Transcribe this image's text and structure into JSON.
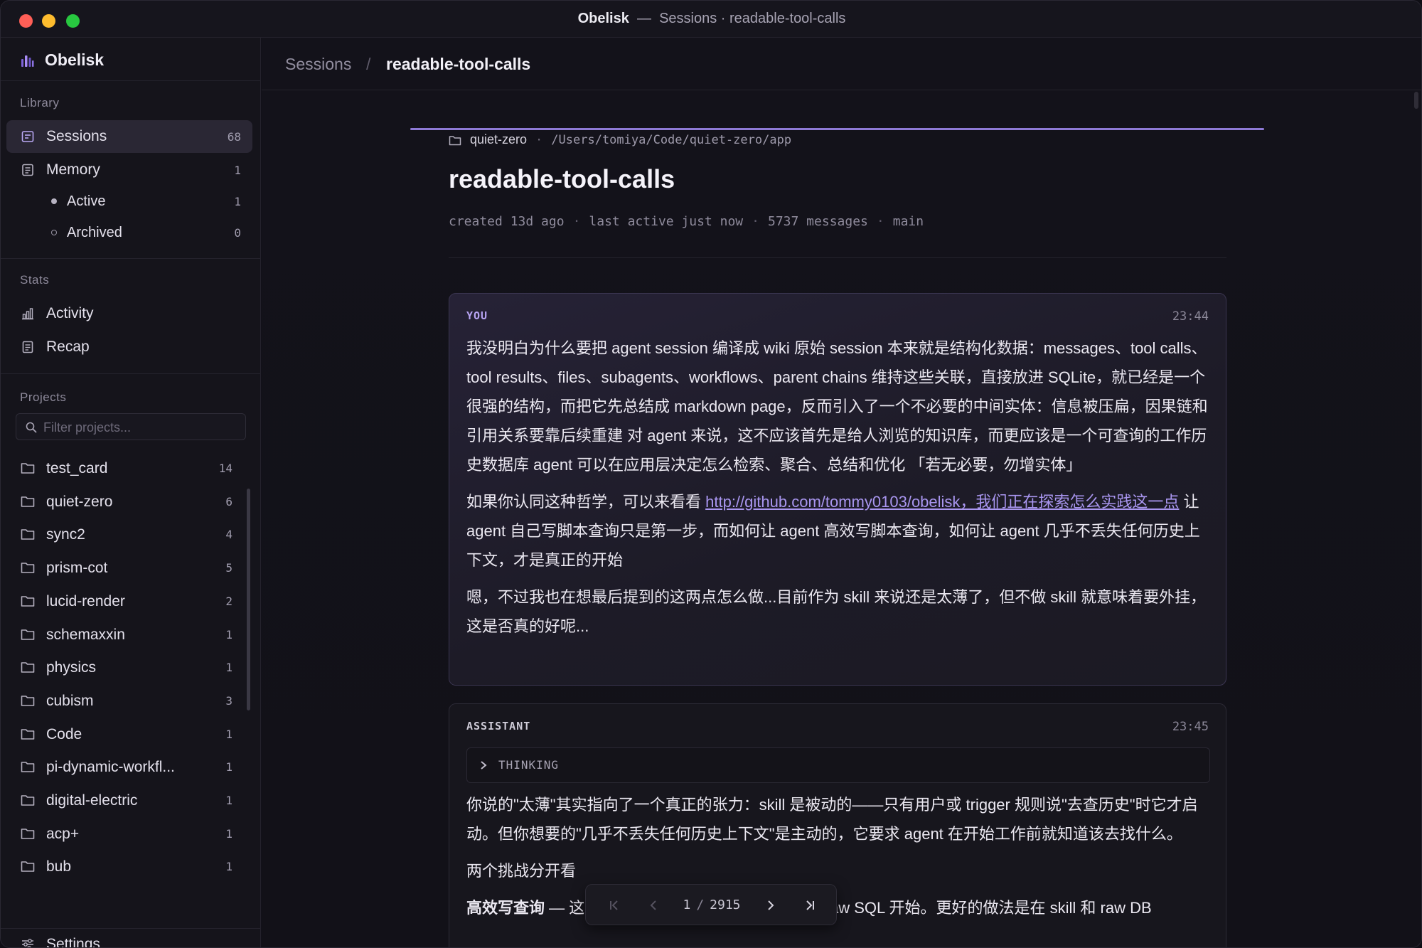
{
  "window": {
    "app_name": "Obelisk",
    "separator": "—",
    "subtitle": "Sessions · readable-tool-calls"
  },
  "sidebar": {
    "brand": "Obelisk",
    "library_heading": "Library",
    "library": [
      {
        "label": "Sessions",
        "count": "68",
        "icon": "sessions-icon"
      },
      {
        "label": "Memory",
        "count": "1",
        "icon": "memory-icon"
      },
      {
        "label": "Active",
        "count": "1",
        "icon": "dot-filled"
      },
      {
        "label": "Archived",
        "count": "0",
        "icon": "dot-hollow"
      }
    ],
    "stats_heading": "Stats",
    "stats": [
      {
        "label": "Activity",
        "icon": "bar-chart-icon"
      },
      {
        "label": "Recap",
        "icon": "document-icon"
      }
    ],
    "projects_heading": "Projects",
    "filter_placeholder": "Filter projects...",
    "projects": [
      {
        "label": "test_card",
        "count": "14"
      },
      {
        "label": "quiet-zero",
        "count": "6"
      },
      {
        "label": "sync2",
        "count": "4"
      },
      {
        "label": "prism-cot",
        "count": "5"
      },
      {
        "label": "lucid-render",
        "count": "2"
      },
      {
        "label": "schemaxxin",
        "count": "1"
      },
      {
        "label": "physics",
        "count": "1"
      },
      {
        "label": "cubism",
        "count": "3"
      },
      {
        "label": "Code",
        "count": "1"
      },
      {
        "label": "pi-dynamic-workfl...",
        "count": "1"
      },
      {
        "label": "digital-electric",
        "count": "1"
      },
      {
        "label": "acp+",
        "count": "1"
      },
      {
        "label": "bub",
        "count": "1"
      }
    ],
    "settings_label": "Settings"
  },
  "topbar": {
    "crumb_root": "Sessions",
    "crumb_sep": "/",
    "crumb_current": "readable-tool-calls"
  },
  "session": {
    "project": "quiet-zero",
    "path_sep": "·",
    "path": "/Users/tomiya/Code/quiet-zero/app",
    "title": "readable-tool-calls",
    "meta": [
      "created 13d ago",
      "last active just now",
      "5737 messages",
      "main"
    ],
    "meta_sep": "·"
  },
  "messages": [
    {
      "role": "YOU",
      "time": "23:44",
      "p1": "我没明白为什么要把 agent session 编译成 wiki 原始 session 本来就是结构化数据：messages、tool calls、tool results、files、subagents、workflows、parent chains 维持这些关联，直接放进 SQLite，就已经是一个很强的结构，而把它先总结成 markdown page，反而引入了一个不必要的中间实体：信息被压扁，因果链和引用关系要靠后续重建 对 agent 来说，这不应该首先是给人浏览的知识库，而更应该是一个可查询的工作历史数据库 agent 可以在应用层决定怎么检索、聚合、总结和优化 「若无必要，勿增实体」",
      "p2_before": "如果你认同这种哲学，可以来看看 ",
      "p2_link": "http://github.com/tommy0103/obelisk，我们正在探索怎么实践这一点",
      "p2_after": " 让 agent 自己写脚本查询只是第一步，而如何让 agent 高效写脚本查询，如何让 agent 几乎不丢失任何历史上下文，才是真正的开始",
      "p3": "嗯，不过我也在想最后提到的这两点怎么做...目前作为 skill 来说还是太薄了，但不做 skill 就意味着要外挂，这是否真的好呢..."
    },
    {
      "role": "ASSISTANT",
      "time": "23:45",
      "thinking_label": "THINKING",
      "p1": "你说的\"太薄\"其实指向了一个真正的张力：skill 是被动的——只有用户或 trigger 规则说\"去查历史\"时它才启动。但你想要的\"几乎不丢失任何历史上下文\"是主动的，它要求 agent 在开始工作前就知道该去找什么。",
      "p2": "两个挑战分开看",
      "p3_bold": "高效写查询",
      "p3_rest": " — 这个问题其实不该让 agent 每次都从 raw SQL 开始。更好的做法是在 skill 和 raw DB"
    }
  ],
  "pager": {
    "current": "1",
    "sep": "/",
    "total": "2915"
  },
  "colors": {
    "accent": "#8e7ad6",
    "link": "#a996f0",
    "user_role": "#b7a4f2"
  }
}
